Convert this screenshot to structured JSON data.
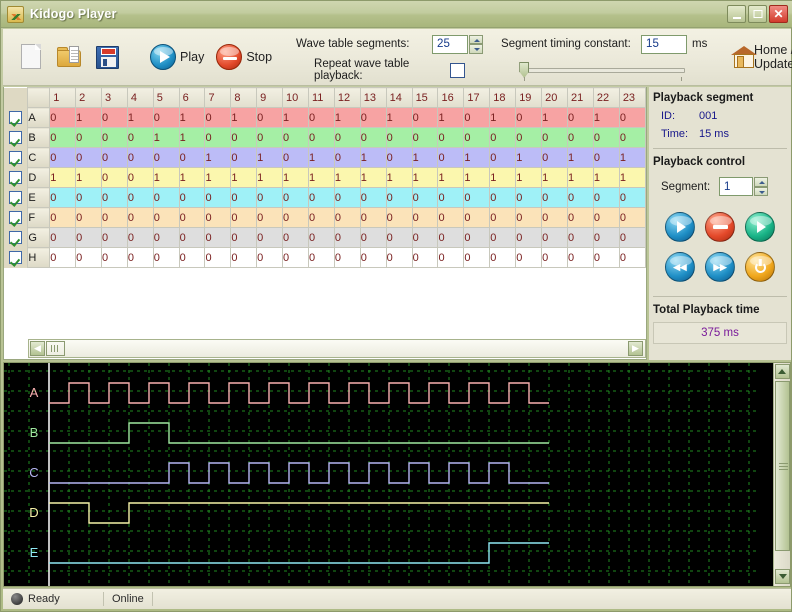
{
  "window": {
    "title": "Kidogo Player",
    "icon": "app-icon",
    "minimize_label": "_",
    "maximize_label": "□",
    "close_label": "✕"
  },
  "toolbar": {
    "new_icon": "new-document-icon",
    "open_icon": "open-folder-icon",
    "save_icon": "save-floppy-icon",
    "play_label": "Play",
    "stop_label": "Stop",
    "wave_segments_label": "Wave table segments:",
    "wave_segments_value": "25",
    "repeat_label": "Repeat wave table playback:",
    "repeat_checked": false,
    "timing_label": "Segment timing constant:",
    "timing_value": "15",
    "timing_unit": "ms",
    "home_label": "Home / Updates",
    "help_label": "?"
  },
  "grid": {
    "columns": [
      "1",
      "2",
      "3",
      "4",
      "5",
      "6",
      "7",
      "8",
      "9",
      "10",
      "11",
      "12",
      "13",
      "14",
      "15",
      "16",
      "17",
      "18",
      "19",
      "20",
      "21",
      "22",
      "23"
    ],
    "rows": [
      {
        "label": "A",
        "checked": true,
        "color": "#f7a3a3",
        "values": [
          "0",
          "1",
          "0",
          "1",
          "0",
          "1",
          "0",
          "1",
          "0",
          "1",
          "0",
          "1",
          "0",
          "1",
          "0",
          "1",
          "0",
          "1",
          "0",
          "1",
          "0",
          "1",
          "0"
        ]
      },
      {
        "label": "B",
        "checked": true,
        "color": "#a5efa5",
        "values": [
          "0",
          "0",
          "0",
          "0",
          "1",
          "1",
          "0",
          "0",
          "0",
          "0",
          "0",
          "0",
          "0",
          "0",
          "0",
          "0",
          "0",
          "0",
          "0",
          "0",
          "0",
          "0",
          "0"
        ]
      },
      {
        "label": "C",
        "checked": true,
        "color": "#bcbcf7",
        "values": [
          "0",
          "0",
          "0",
          "0",
          "0",
          "0",
          "1",
          "0",
          "1",
          "0",
          "1",
          "0",
          "1",
          "0",
          "1",
          "0",
          "1",
          "0",
          "1",
          "0",
          "1",
          "0",
          "1"
        ]
      },
      {
        "label": "D",
        "checked": true,
        "color": "#fbf7ae",
        "values": [
          "1",
          "1",
          "0",
          "0",
          "1",
          "1",
          "1",
          "1",
          "1",
          "1",
          "1",
          "1",
          "1",
          "1",
          "1",
          "1",
          "1",
          "1",
          "1",
          "1",
          "1",
          "1",
          "1"
        ]
      },
      {
        "label": "E",
        "checked": true,
        "color": "#9ff1f7",
        "values": [
          "0",
          "0",
          "0",
          "0",
          "0",
          "0",
          "0",
          "0",
          "0",
          "0",
          "0",
          "0",
          "0",
          "0",
          "0",
          "0",
          "0",
          "0",
          "0",
          "0",
          "0",
          "0",
          "0"
        ]
      },
      {
        "label": "F",
        "checked": true,
        "color": "#fbe3b9",
        "values": [
          "0",
          "0",
          "0",
          "0",
          "0",
          "0",
          "0",
          "0",
          "0",
          "0",
          "0",
          "0",
          "0",
          "0",
          "0",
          "0",
          "0",
          "0",
          "0",
          "0",
          "0",
          "0",
          "0"
        ]
      },
      {
        "label": "G",
        "checked": true,
        "color": "#dedede",
        "values": [
          "0",
          "0",
          "0",
          "0",
          "0",
          "0",
          "0",
          "0",
          "0",
          "0",
          "0",
          "0",
          "0",
          "0",
          "0",
          "0",
          "0",
          "0",
          "0",
          "0",
          "0",
          "0",
          "0"
        ]
      },
      {
        "label": "H",
        "checked": true,
        "color": "#ffffff",
        "values": [
          "0",
          "0",
          "0",
          "0",
          "0",
          "0",
          "0",
          "0",
          "0",
          "0",
          "0",
          "0",
          "0",
          "0",
          "0",
          "0",
          "0",
          "0",
          "0",
          "0",
          "0",
          "0",
          "0"
        ]
      }
    ],
    "scroll_left_icon": "scroll-left-icon",
    "scroll_right_icon": "scroll-right-icon"
  },
  "panel": {
    "segment_heading": "Playback segment",
    "id_label": "ID:",
    "id_value": "001",
    "time_label": "Time:",
    "time_value": "15 ms",
    "control_heading": "Playback control",
    "segment_label": "Segment:",
    "segment_value": "1",
    "buttons": [
      {
        "name": "play-button",
        "icon": "play-icon",
        "color": "#1f8fc6"
      },
      {
        "name": "stop-button",
        "icon": "stop-icon",
        "color": "#e4492a"
      },
      {
        "name": "step-button",
        "icon": "step-play-icon",
        "color": "#19b487"
      },
      {
        "name": "rewind-button",
        "icon": "rewind-icon",
        "color": "#1f8fc6"
      },
      {
        "name": "fast-forward-button",
        "icon": "fast-forward-icon",
        "color": "#1f8fc6"
      },
      {
        "name": "reset-button",
        "icon": "power-icon",
        "color": "#f0a71c"
      }
    ],
    "total_heading": "Total Playback time",
    "total_value": "375 ms"
  },
  "wave": {
    "background": "#000000",
    "grid_color": "#1f8a1f",
    "channels": [
      {
        "label": "A",
        "color": "#f9b0b0",
        "values": [
          0,
          1,
          0,
          1,
          0,
          1,
          0,
          1,
          0,
          1,
          0,
          1,
          0,
          1,
          0,
          1,
          0,
          1,
          0,
          1,
          0,
          1,
          0,
          1,
          0
        ]
      },
      {
        "label": "B",
        "color": "#9fe89f",
        "values": [
          0,
          0,
          0,
          0,
          1,
          1,
          0,
          0,
          0,
          0,
          0,
          0,
          0,
          0,
          0,
          0,
          0,
          0,
          0,
          0,
          0,
          0,
          0,
          0,
          0
        ]
      },
      {
        "label": "C",
        "color": "#b6b6f2",
        "values": [
          0,
          0,
          0,
          0,
          0,
          0,
          1,
          0,
          1,
          0,
          1,
          0,
          1,
          0,
          1,
          0,
          1,
          0,
          1,
          0,
          1,
          0,
          1,
          0,
          0
        ]
      },
      {
        "label": "D",
        "color": "#f6f2a8",
        "values": [
          1,
          1,
          0,
          0,
          1,
          1,
          1,
          1,
          1,
          1,
          1,
          1,
          1,
          1,
          1,
          1,
          1,
          1,
          1,
          1,
          1,
          1,
          1,
          1,
          1
        ]
      },
      {
        "label": "E",
        "color": "#8fe8f2",
        "values": [
          0,
          0,
          0,
          0,
          0,
          0,
          0,
          0,
          0,
          0,
          0,
          0,
          0,
          0,
          0,
          0,
          0,
          0,
          0,
          0,
          0,
          0,
          1,
          1,
          1
        ]
      }
    ],
    "segment_count": 25,
    "scroll_up_icon": "scroll-up-icon",
    "scroll_down_icon": "scroll-down-icon"
  },
  "status": {
    "ready_label": "Ready",
    "connection_label": "Online",
    "indicator_icon": "status-dot-icon"
  }
}
